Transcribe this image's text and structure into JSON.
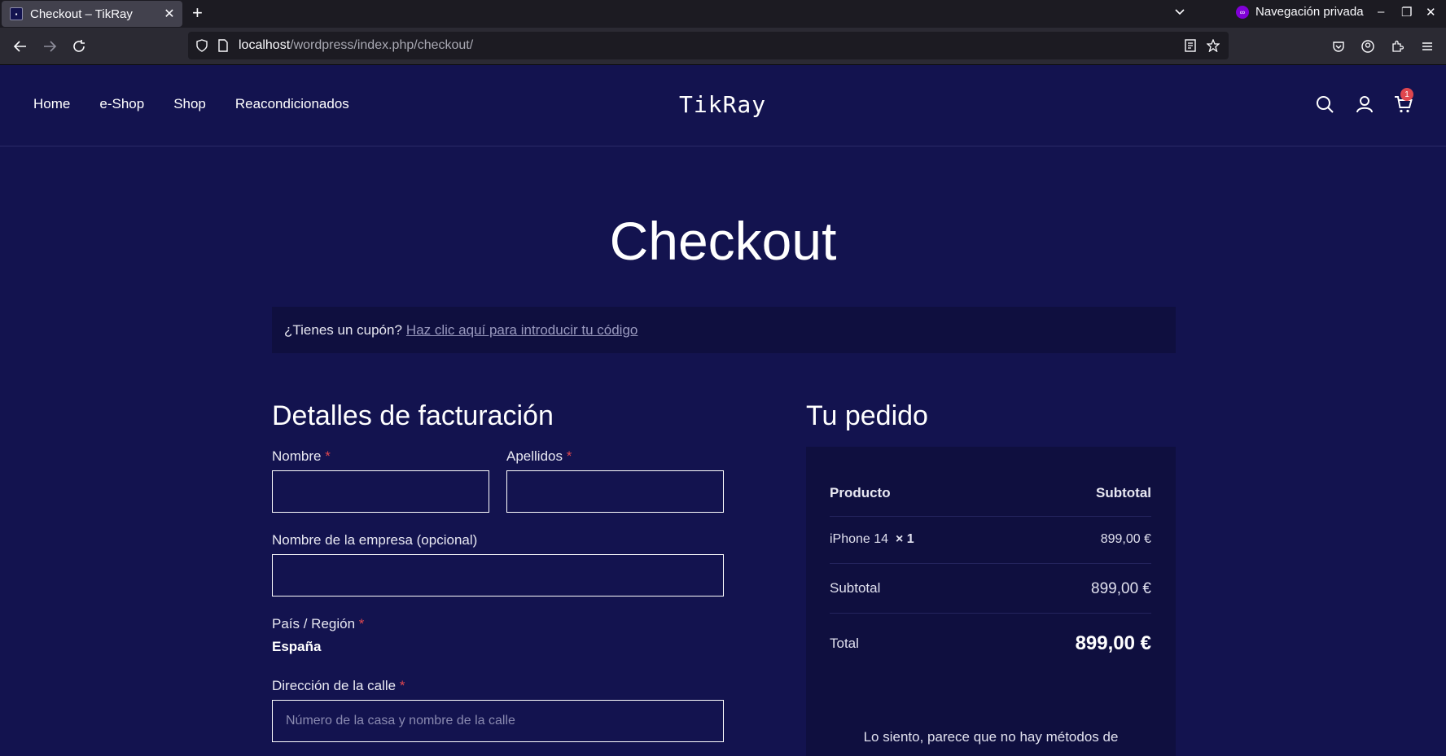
{
  "browser": {
    "tab_title": "Checkout – TikRay",
    "private_label": "Navegación privada",
    "url_host": "localhost",
    "url_path": "/wordpress/index.php/checkout/"
  },
  "header": {
    "menu": [
      "Home",
      "e-Shop",
      "Shop",
      "Reacondicionados"
    ],
    "logo": "TikRay",
    "cart_count": "1"
  },
  "page": {
    "title": "Checkout",
    "coupon_question": "¿Tienes un cupón?",
    "coupon_link": "Haz clic aquí para introducir tu código"
  },
  "billing": {
    "heading": "Detalles de facturación",
    "first_name_label": "Nombre",
    "last_name_label": "Apellidos",
    "company_label": "Nombre de la empresa (opcional)",
    "country_label": "País / Región",
    "country_value": "España",
    "street_label": "Dirección de la calle",
    "street_placeholder": "Número de la casa y nombre de la calle",
    "required_mark": "*"
  },
  "order": {
    "heading": "Tu pedido",
    "col_product": "Producto",
    "col_subtotal": "Subtotal",
    "item_name": "iPhone 14",
    "item_qty": "× 1",
    "item_price": "899,00 €",
    "subtotal_label": "Subtotal",
    "subtotal_value": "899,00 €",
    "total_label": "Total",
    "total_value": "899,00 €",
    "no_payment_text": "Lo siento, parece que no hay métodos de"
  },
  "colors": {
    "page_bg": "#13134f",
    "panel_bg": "#0f0f3f",
    "required": "#e0464e"
  }
}
